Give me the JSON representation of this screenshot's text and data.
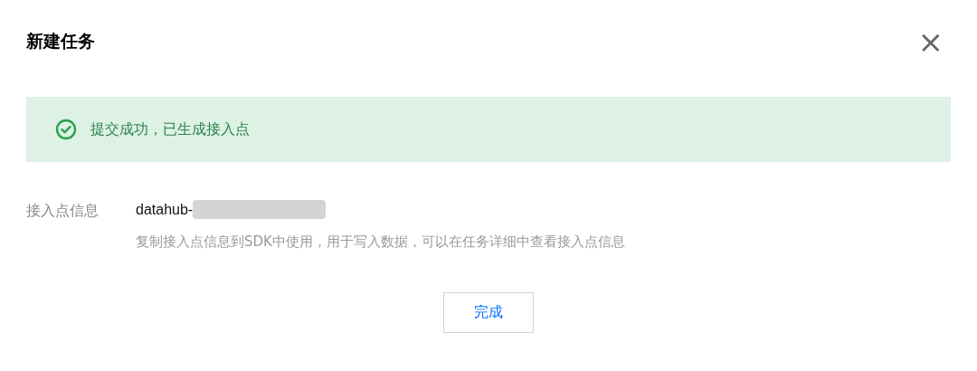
{
  "dialog": {
    "title": "新建任务",
    "close": "×"
  },
  "alert": {
    "kind": "success",
    "message": "提交成功，已生成接入点"
  },
  "field": {
    "label": "接入点信息",
    "value": "datahub-",
    "hint": "复制接入点信息到SDK中使用，用于写入数据，可以在任务详细中查看接入点信息"
  },
  "buttons": [
    {
      "label": "完成"
    }
  ]
}
